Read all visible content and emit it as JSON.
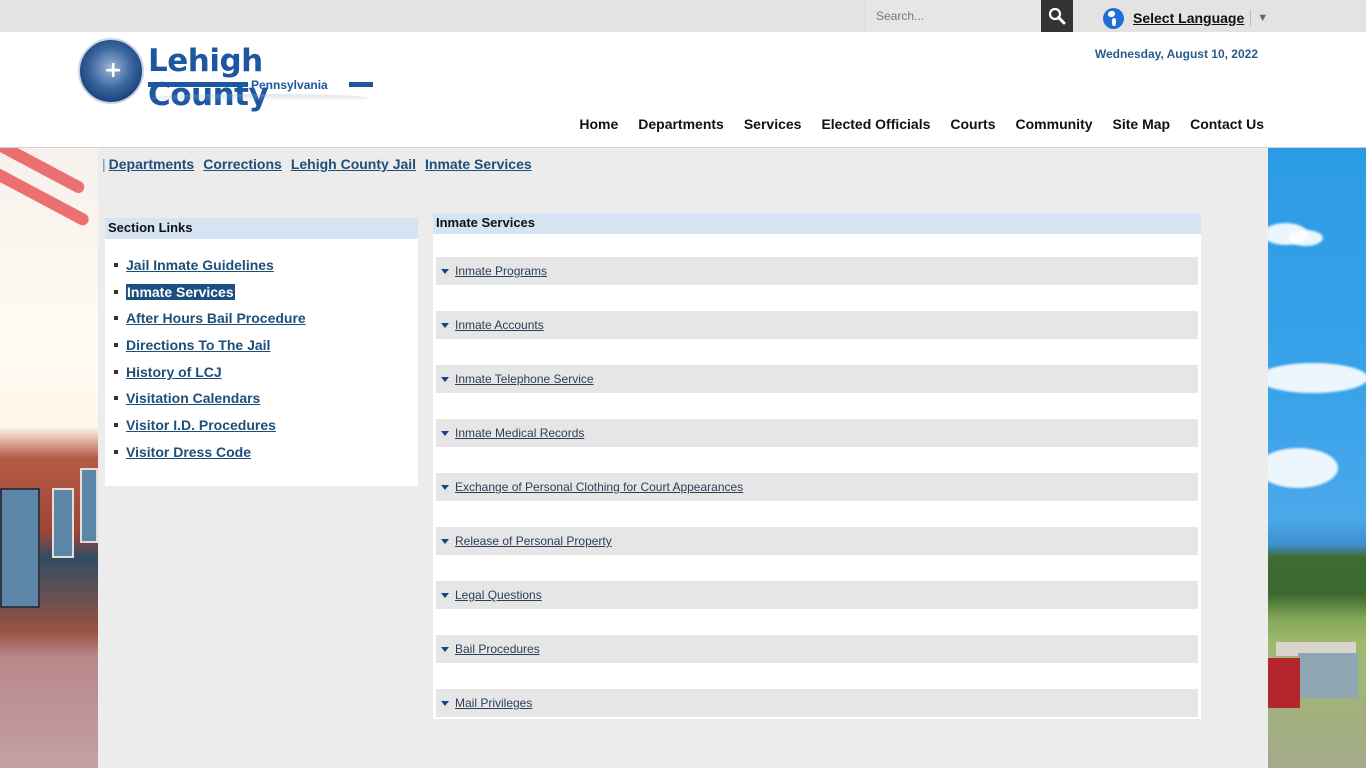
{
  "topbar": {
    "search_placeholder": "Search...",
    "search_icon": "magnifier-icon",
    "language_icon": "globe-icon",
    "language_label": "Select Language",
    "language_arrow": "▼"
  },
  "header": {
    "logo_title": "Lehigh County",
    "logo_subtitle": "Pennsylvania",
    "date": "Wednesday, August 10, 2022",
    "nav": [
      "Home",
      "Departments",
      "Services",
      "Elected Officials",
      "Courts",
      "Community",
      "Site Map",
      "Contact Us"
    ]
  },
  "breadcrumb": {
    "separator": "|",
    "items": [
      "Departments",
      "Corrections",
      "Lehigh County Jail",
      "Inmate Services"
    ]
  },
  "section_links": {
    "title": "Section Links",
    "items": [
      {
        "label": "Jail Inmate Guidelines",
        "active": false
      },
      {
        "label": "Inmate Services",
        "active": true
      },
      {
        "label": "After Hours Bail Procedure",
        "active": false
      },
      {
        "label": "Directions To The Jail",
        "active": false
      },
      {
        "label": "History of LCJ",
        "active": false
      },
      {
        "label": "Visitation Calendars",
        "active": false
      },
      {
        "label": "Visitor I.D. Procedures",
        "active": false
      },
      {
        "label": "Visitor Dress Code",
        "active": false
      }
    ]
  },
  "main": {
    "title": "Inmate Services",
    "accordion": [
      "Inmate Programs",
      "Inmate Accounts",
      "Inmate Telephone Service",
      "Inmate Medical Records",
      "Exchange of Personal Clothing for Court Appearances",
      "Release of Personal Property",
      "Legal Questions",
      "Bail Procedures",
      "Mail Privileges"
    ]
  },
  "colors": {
    "brand_blue": "#1d57a0",
    "link": "#1e4f79",
    "panel_header": "#d4e4f2",
    "active_link_bg": "#1c4f82",
    "accordion_bg": "#e6e6e6",
    "date": "#2a5c8a"
  }
}
